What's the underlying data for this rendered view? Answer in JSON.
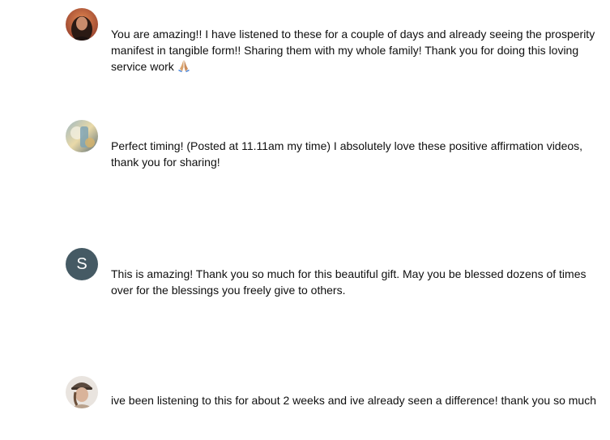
{
  "comments": [
    {
      "text": "You are amazing!! I have listened to these for a couple of days and already seeing the prosperity manifest in tangible form!! Sharing them with my whole family! Thank you for doing this loving service work",
      "emoji": "praying-hands-icon"
    },
    {
      "text": "Perfect timing! (Posted at 11.11am my time) I absolutely love these positive affirmation videos, thank you for sharing!"
    },
    {
      "avatar_letter": "S",
      "avatar_color": "#455a64",
      "text": "This is amazing! Thank you so much for this beautiful gift. May you be blessed dozens of times over for the blessings you freely give to others."
    },
    {
      "text": "ive been listening to this for about 2 weeks and ive already seen a difference! thank you so much"
    }
  ]
}
